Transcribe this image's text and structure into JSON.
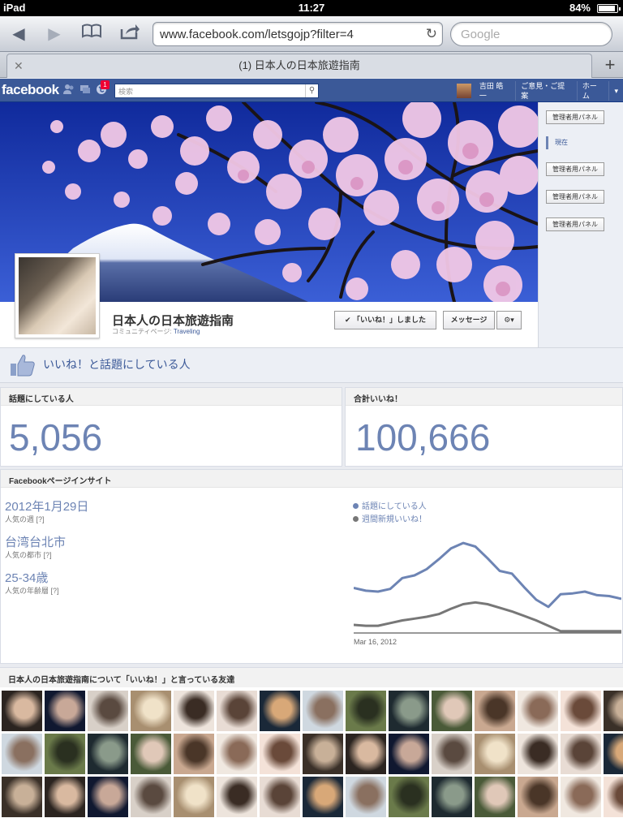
{
  "status_bar": {
    "device": "iPad",
    "time": "11:27",
    "battery": "84%"
  },
  "browser": {
    "url": "www.facebook.com/letsgojp?filter=4",
    "search_placeholder": "Google",
    "tab_title": "(1) 日本人の日本旅遊指南"
  },
  "fb_header": {
    "logo": "facebook",
    "notification_count": "1",
    "search_placeholder": "検索",
    "user_name": "吉田 皓一",
    "feedback": "ご意見・ご提案",
    "home": "ホーム"
  },
  "sidebar": {
    "admin_panel": "管理者用パネル",
    "now": "現在"
  },
  "page": {
    "name": "日本人の日本旅遊指南",
    "category_prefix": "コミュニティページ:",
    "category": "Traveling",
    "liked_button": "「いいね！」しました",
    "message_button": "メッセージ"
  },
  "likes_header": "いいね！と話題にしている人",
  "stats": {
    "talking_label": "話題にしている人",
    "talking_value": "5,056",
    "total_likes_label": "合計いいね！",
    "total_likes_value": "100,666"
  },
  "insights": {
    "header": "Facebookページインサイト",
    "popular_week": "2012年1月29日",
    "popular_week_label": "人気の週 [?]",
    "popular_city": "台湾台北市",
    "popular_city_label": "人気の都市 [?]",
    "popular_age": "25-34歳",
    "popular_age_label": "人気の年齢層 [?]",
    "legend_talking": "話題にしている人",
    "legend_new_likes": "週間新規いいね！",
    "x_label": "Mar 16, 2012"
  },
  "chart_data": {
    "type": "line",
    "title": "",
    "xlabel": "Mar 16, 2012",
    "ylabel": "",
    "series": [
      {
        "name": "話題にしている人",
        "values": [
          50,
          47,
          46,
          49,
          61,
          64,
          71,
          82,
          94,
          100,
          96,
          83,
          69,
          66,
          51,
          37,
          29,
          43,
          44,
          46,
          42,
          41,
          38
        ]
      },
      {
        "name": "週間新規いいね！",
        "values": [
          9,
          8,
          8,
          11,
          14,
          16,
          18,
          21,
          27,
          32,
          34,
          32,
          28,
          24,
          19,
          14,
          8,
          2,
          2,
          2,
          2,
          2,
          2
        ]
      }
    ],
    "ylim": [
      0,
      110
    ],
    "colors": [
      "#6d84b4",
      "#777777"
    ]
  },
  "friends": {
    "header": "日本人の日本旅遊指南について「いいね！」と言っている友達",
    "count": 45
  }
}
